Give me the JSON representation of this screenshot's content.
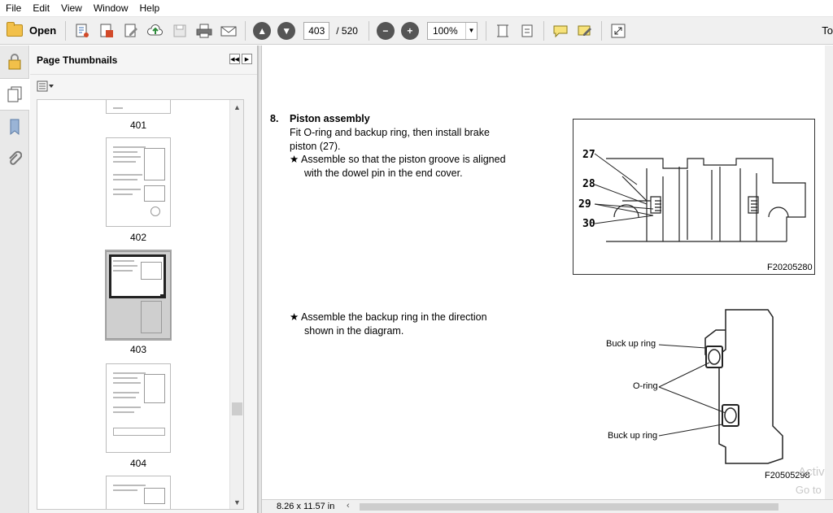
{
  "menu": [
    "File",
    "Edit",
    "View",
    "Window",
    "Help"
  ],
  "toolbar": {
    "open_label": "Open",
    "current_page": "403",
    "total_pages": "/ 520",
    "zoom": "100%",
    "tools_label": "To"
  },
  "sidebar": {
    "title": "Page Thumbnails",
    "thumbnails": [
      {
        "page": "401"
      },
      {
        "page": "402"
      },
      {
        "page": "403",
        "selected": true
      },
      {
        "page": "404"
      }
    ]
  },
  "document": {
    "section_number": "8.",
    "section_title": "Piston assembly",
    "para1_line1": "Fit O-ring and backup ring, then install brake",
    "para1_line2": "piston (27).",
    "bullet1_line1": "★ Assemble so that the piston groove is aligned",
    "bullet1_line2": "with the dowel pin in the end cover.",
    "bullet2_line1": "★ Assemble the backup ring in the direction",
    "bullet2_line2": "shown in the diagram.",
    "figure1": {
      "labels": [
        "27",
        "28",
        "29",
        "30"
      ],
      "caption": "F20205280"
    },
    "figure2": {
      "label_top": "Buck up ring",
      "label_mid": "O-ring",
      "label_bottom": "Buck up ring",
      "caption": "F20505298"
    }
  },
  "status": {
    "page_size": "8.26 x 11.57 in"
  },
  "watermark": {
    "line1": "Activa",
    "line2": "Go to S"
  }
}
